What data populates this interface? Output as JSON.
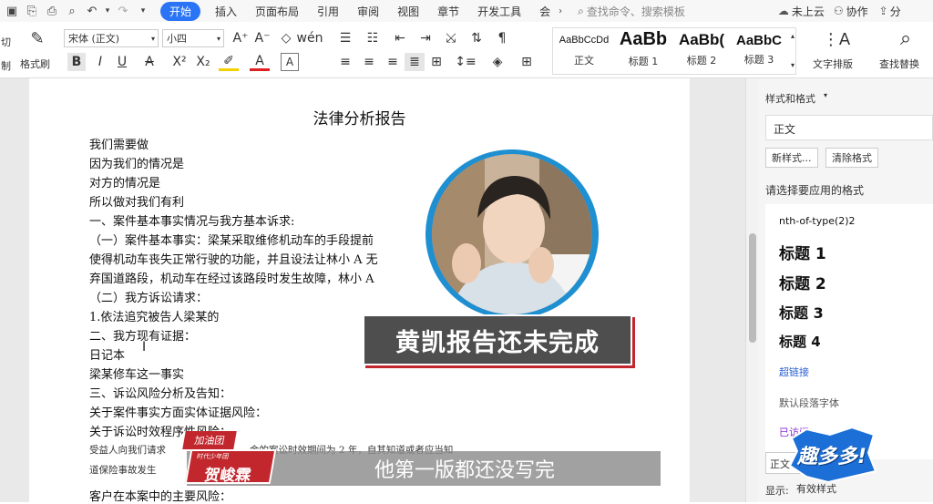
{
  "menubar": {
    "tabs": [
      "开始",
      "插入",
      "页面布局",
      "引用",
      "审阅",
      "视图",
      "章节",
      "开发工具",
      "会"
    ],
    "active_tab": "开始",
    "search_placeholder": "查找命令、搜索模板",
    "cloud": "未上云",
    "collab": "协作",
    "share": "分"
  },
  "ribbon": {
    "cut": "切",
    "copy": "制",
    "format_painter": "格式刷",
    "font_name": "宋体 (正文)",
    "font_size": "小四",
    "styles": [
      {
        "preview": "AaBbCcDd",
        "name": "正文"
      },
      {
        "preview": "AaBb",
        "name": "标题 1"
      },
      {
        "preview": "AaBb(",
        "name": "标题 2"
      },
      {
        "preview": "AaBbC",
        "name": "标题 3"
      }
    ],
    "text_layout": "文字排版",
    "find_replace": "查找替换"
  },
  "document": {
    "title": "法律分析报告",
    "lines": [
      "我们需要做",
      "因为我们的情况是",
      "对方的情况是",
      "所以做对我们有利",
      "一、案件基本事实情况与我方基本诉求:",
      "（一）案件基本事实：梁某采取维修机动车的手段提前",
      "使得机动车丧失正常行驶的功能，并且设法让林小 A 无",
      "弃国道路段，机动车在经过该路段时发生故障，林小 A",
      "（二）我方诉讼请求：",
      "1.依法追究被告人梁某的",
      "二、我方现有证据：",
      "日记本",
      "梁某修车这一事实",
      "三、诉讼风险分析及告知：",
      "关于案件事实方面实体证据风险：",
      "关于诉讼时效程序性风险："
    ],
    "small_lines": [
      "受益人向我们请求",
      "金的案讼时效期间为 2 年，自其知道或者应当知",
      "道保险事故发生"
    ],
    "last_line": "客户在本案中的主要风险："
  },
  "panel": {
    "title": "样式和格式",
    "current_style": "正文",
    "new_style": "新样式...",
    "clear_format": "清除格式",
    "apply_label": "请选择要应用的格式",
    "items": [
      "nth-of-type(2)2",
      "标题 1",
      "标题 2",
      "标题 3",
      "标题 4",
      "超链接",
      "默认段落字体",
      "已访问"
    ],
    "style_field": "正文",
    "show_label": "显示:",
    "show_value": "有效样式"
  },
  "overlay": {
    "subtitle": "黄凯报告还未完成",
    "bottom": "他第一版都还没写完",
    "tag_top": "加油团",
    "tag_small": "时代少年团",
    "tag_name": "贺峻霖",
    "logo": "趣多多!"
  },
  "colors": {
    "accent": "#2a74f5",
    "overlay_red": "#c1272d",
    "photo_ring": "#1e8fd1"
  }
}
